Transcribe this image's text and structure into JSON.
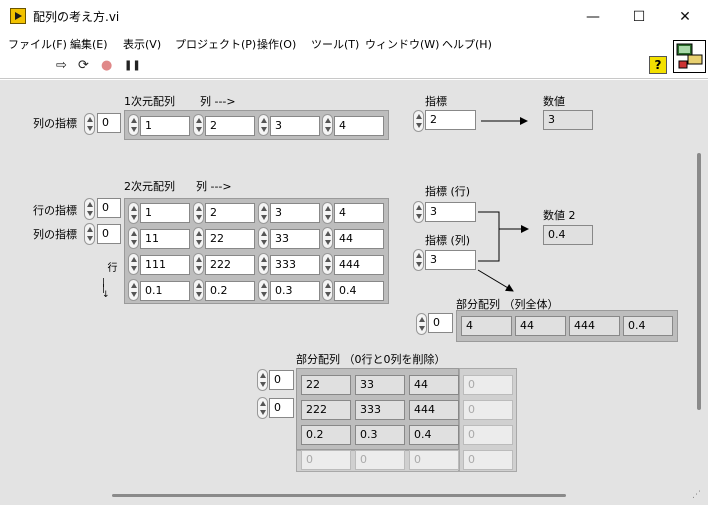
{
  "window": {
    "title": "配列の考え方.vi",
    "minimize": "—",
    "maximize": "☐",
    "close": "✕"
  },
  "menu": [
    "ファイル(F)",
    "編集(E)",
    "表示(V)",
    "プロジェクト(P)",
    "操作(O)",
    "ツール(T)",
    "ウィンドウ(W)",
    "ヘルプ(H)"
  ],
  "toolbar": {
    "run": "⇨",
    "run_continuous": "⟳",
    "abort": "●",
    "pause": "❚❚",
    "help": "?"
  },
  "array1d": {
    "title": "1次元配列",
    "col_label": "列 --->",
    "index_label": "列の指標",
    "index_value": "0",
    "values": [
      "1",
      "2",
      "3",
      "4"
    ]
  },
  "index_block": {
    "label": "指標",
    "value": "2",
    "output_label": "数値",
    "output_value": "3"
  },
  "array2d": {
    "title": "2次元配列",
    "col_label": "列 --->",
    "row_index_label": "行の指標",
    "row_index_value": "0",
    "col_index_label": "列の指標",
    "col_index_value": "0",
    "row_axis_label": "行",
    "rows": [
      [
        "1",
        "2",
        "3",
        "4"
      ],
      [
        "11",
        "22",
        "33",
        "44"
      ],
      [
        "111",
        "222",
        "333",
        "444"
      ],
      [
        "0.1",
        "0.2",
        "0.3",
        "0.4"
      ]
    ]
  },
  "index2d_block": {
    "row_label": "指標 (行)",
    "row_value": "3",
    "col_label": "指標 (列)",
    "col_value": "3",
    "output_label": "数値 2",
    "output_value": "0.4"
  },
  "subarray": {
    "label": "部分配列 （列全体）",
    "index_value": "0",
    "values": [
      "4",
      "44",
      "444",
      "0.4"
    ]
  },
  "subarray2": {
    "label": "部分配列 （0行と0列を削除）",
    "row_index_value": "0",
    "col_index_value": "0",
    "rows": [
      [
        "22",
        "33",
        "44",
        "0"
      ],
      [
        "222",
        "333",
        "444",
        "0"
      ],
      [
        "0.2",
        "0.3",
        "0.4",
        "0"
      ],
      [
        "0",
        "0",
        "0",
        "0"
      ]
    ]
  }
}
